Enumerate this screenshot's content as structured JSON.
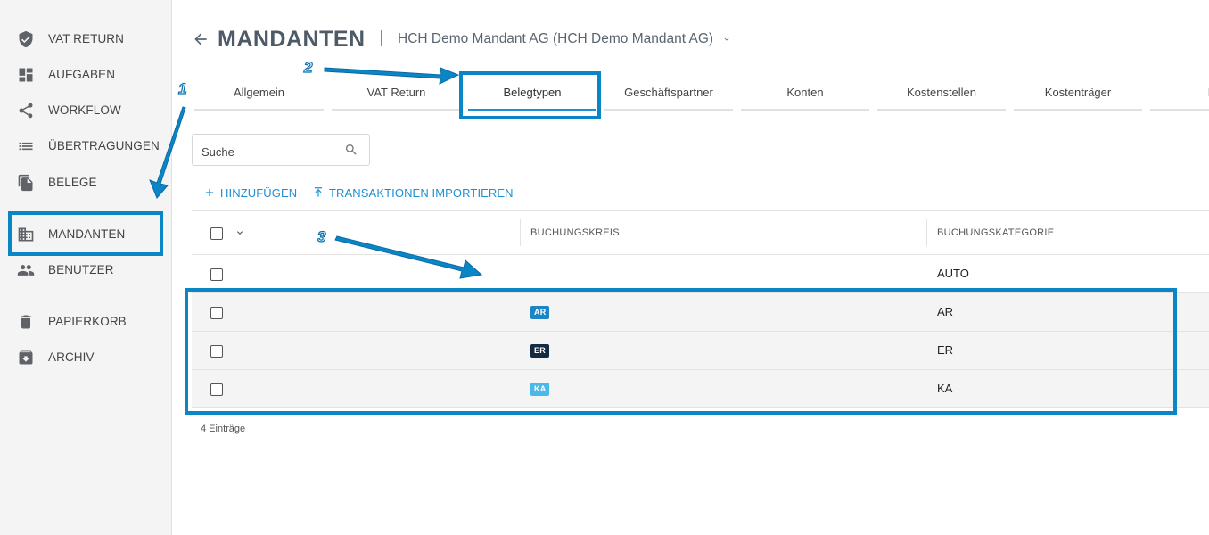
{
  "sidebar": {
    "items": [
      {
        "label": "VAT RETURN",
        "icon": "shield-check-icon"
      },
      {
        "label": "AUFGABEN",
        "icon": "dashboard-icon"
      },
      {
        "label": "WORKFLOW",
        "icon": "share-icon"
      },
      {
        "label": "ÜBERTRAGUNGEN",
        "icon": "list-icon"
      },
      {
        "label": "BELEGE",
        "icon": "file-copy-icon"
      },
      {
        "label": "MANDANTEN",
        "icon": "building-icon"
      },
      {
        "label": "BENUTZER",
        "icon": "people-icon"
      },
      {
        "label": "PAPIERKORB",
        "icon": "trash-icon"
      },
      {
        "label": "ARCHIV",
        "icon": "archive-icon"
      }
    ]
  },
  "header": {
    "title": "MANDANTEN",
    "mandant": "HCH Demo Mandant AG (HCH Demo Mandant AG)"
  },
  "tabs": [
    {
      "label": "Allgemein"
    },
    {
      "label": "VAT Return"
    },
    {
      "label": "Belegtypen",
      "active": true
    },
    {
      "label": "Geschäftspartner"
    },
    {
      "label": "Konten"
    },
    {
      "label": "Kostenstellen"
    },
    {
      "label": "Kostenträger"
    },
    {
      "label": "La"
    }
  ],
  "search": {
    "placeholder": "Suche"
  },
  "actions": {
    "add": "HINZUFÜGEN",
    "import": "TRANSAKTIONEN IMPORTIEREN"
  },
  "table": {
    "columns": [
      "BUCHUNGSKREIS",
      "BUCHUNGSKATEGORIE"
    ],
    "rows": [
      {
        "buchungskreis": "",
        "buchungskategorie": "AUTO"
      },
      {
        "buchungskreis": "AR",
        "buchungskategorie": "AR",
        "badge_color": "#1d84c6"
      },
      {
        "buchungskreis": "ER",
        "buchungskategorie": "ER",
        "badge_color": "#152a43"
      },
      {
        "buchungskreis": "KA",
        "buchungskategorie": "KA",
        "badge_color": "#49b9ec"
      }
    ],
    "entries_label": "4 Einträge"
  },
  "annotations": {
    "step1": "1",
    "step2": "2",
    "step3": "3",
    "color": "#0a86c7"
  }
}
